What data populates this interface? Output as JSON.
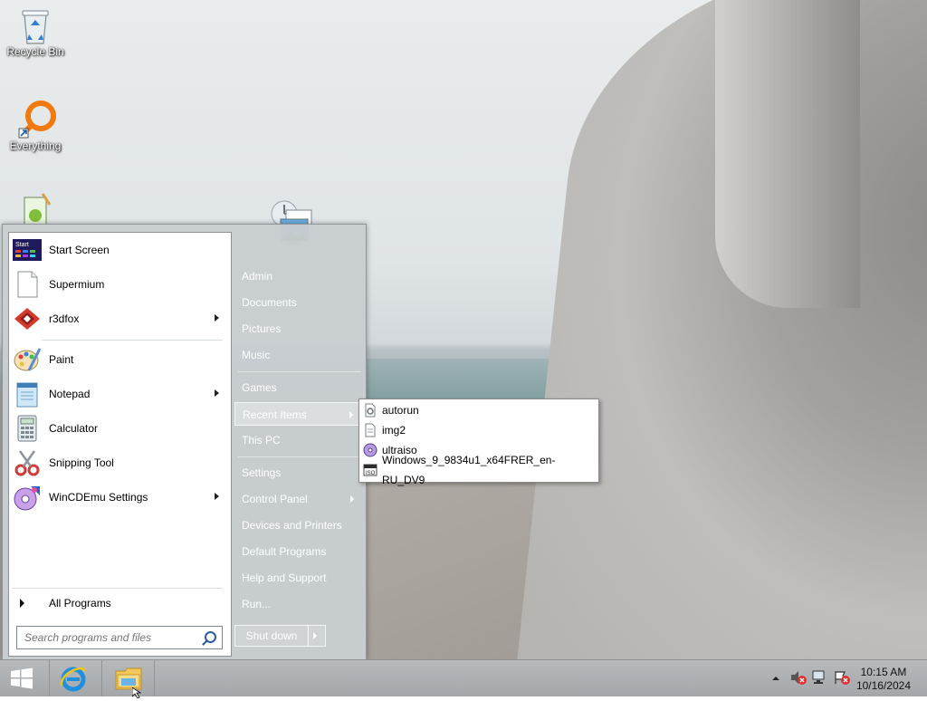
{
  "desktop": {
    "icons": [
      {
        "label": "Recycle Bin"
      },
      {
        "label": "Everything"
      }
    ]
  },
  "start_menu": {
    "programs": [
      {
        "label": "Start Screen",
        "icon": "start-screen-icon"
      },
      {
        "label": "Supermium",
        "icon": "blank-document-icon"
      },
      {
        "label": "r3dfox",
        "icon": "r3dfox-icon",
        "submenu": true
      },
      {
        "label": "Paint",
        "icon": "paint-icon"
      },
      {
        "label": "Notepad",
        "icon": "notepad-icon",
        "submenu": true
      },
      {
        "label": "Calculator",
        "icon": "calculator-icon"
      },
      {
        "label": "Snipping Tool",
        "icon": "snipping-tool-icon"
      },
      {
        "label": "WinCDEmu Settings",
        "icon": "wincdemu-icon",
        "submenu": true
      }
    ],
    "all_programs": "All Programs",
    "search_placeholder": "Search programs and files",
    "right_items": [
      {
        "label": "Admin"
      },
      {
        "label": "Documents"
      },
      {
        "label": "Pictures"
      },
      {
        "label": "Music"
      },
      {
        "label": "Games"
      },
      {
        "label": "Recent Items",
        "submenu": true,
        "highlighted": true
      },
      {
        "label": "This PC"
      },
      {
        "label": "Settings"
      },
      {
        "label": "Control Panel",
        "submenu": true
      },
      {
        "label": "Devices and Printers"
      },
      {
        "label": "Default Programs"
      },
      {
        "label": "Help and Support"
      },
      {
        "label": "Run..."
      }
    ],
    "shutdown_label": "Shut down"
  },
  "recent_items": [
    {
      "label": "autorun",
      "icon": "settings-file-icon"
    },
    {
      "label": "img2",
      "icon": "text-file-icon"
    },
    {
      "label": "ultraiso",
      "icon": "disc-icon"
    },
    {
      "label": "Windows_9_9834u1_x64FRER_en-RU_DV9",
      "icon": "iso-file-icon"
    }
  ],
  "taskbar": {
    "time": "10:15 AM",
    "date": "10/16/2024"
  }
}
